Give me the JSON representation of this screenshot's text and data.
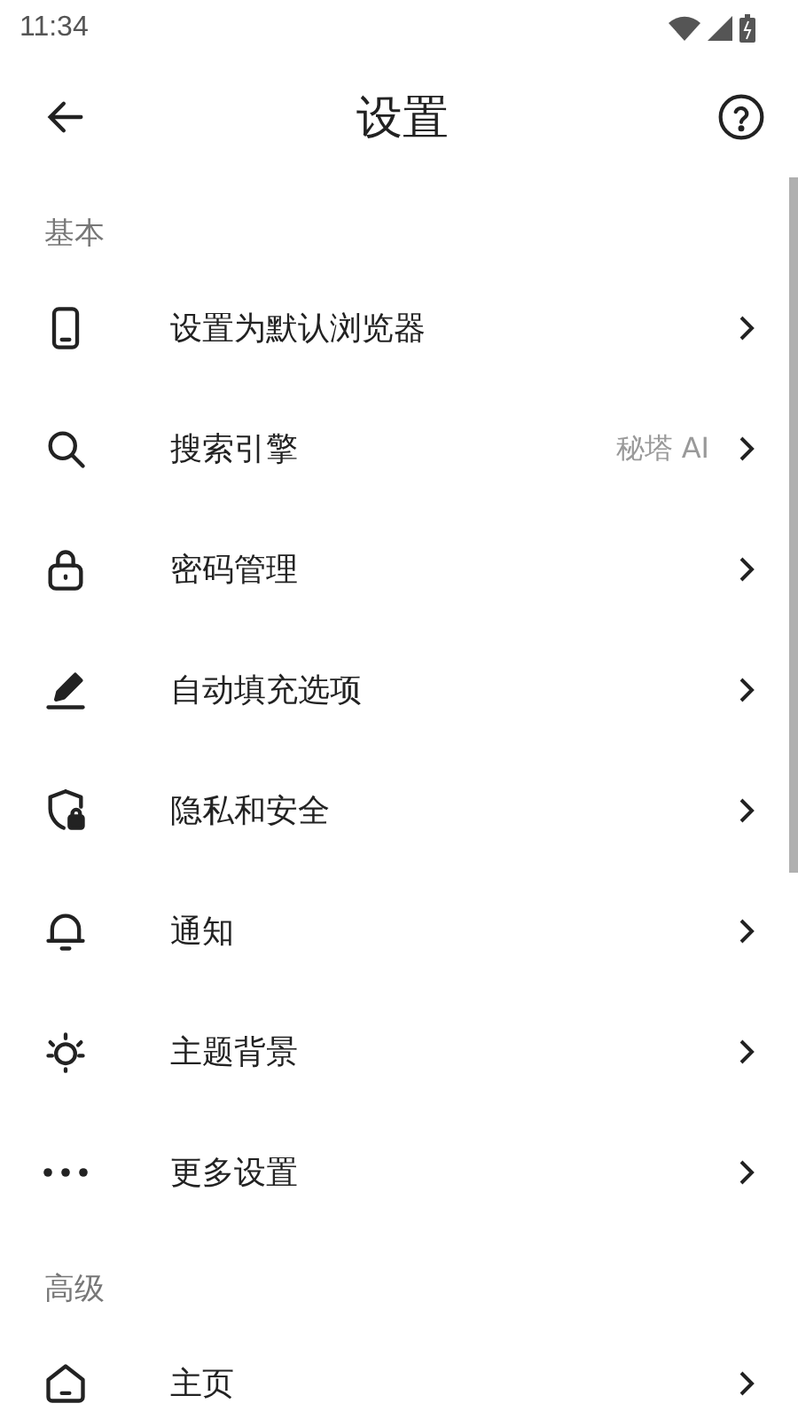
{
  "status_bar": {
    "time": "11:34"
  },
  "header": {
    "title": "设置"
  },
  "sections": [
    {
      "label": "基本",
      "items": [
        {
          "label": "设置为默认浏览器"
        },
        {
          "label": "搜索引擎",
          "value": "秘塔 AI"
        },
        {
          "label": "密码管理"
        },
        {
          "label": "自动填充选项"
        },
        {
          "label": "隐私和安全"
        },
        {
          "label": "通知"
        },
        {
          "label": "主题背景"
        },
        {
          "label": "更多设置"
        }
      ]
    },
    {
      "label": "高级",
      "items": [
        {
          "label": "主页"
        }
      ]
    }
  ]
}
